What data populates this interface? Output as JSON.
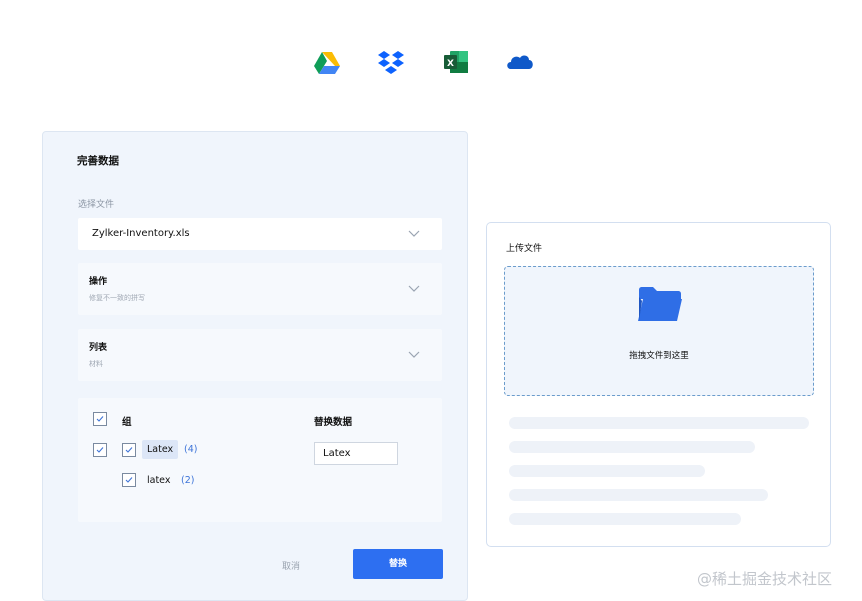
{
  "top_icons": [
    "google-drive-icon",
    "dropbox-icon",
    "excel-icon",
    "onedrive-icon"
  ],
  "left_panel": {
    "title": "完善数据",
    "file_label": "选择文件",
    "file_value": "Zylker-Inventory.xls",
    "action_card": {
      "title": "操作",
      "subtitle": "修复不一致的拼写"
    },
    "list_card": {
      "title": "列表",
      "subtitle": "材料"
    },
    "group": {
      "header": "组",
      "items": [
        {
          "label": "Latex",
          "count": "(4)",
          "checked": true
        },
        {
          "label": "latex",
          "count": "(2)",
          "checked": true
        }
      ],
      "replace_header": "替换数据",
      "replace_value": "Latex"
    },
    "cancel_label": "取消",
    "replace_button": "替换"
  },
  "right_panel": {
    "title": "上传文件",
    "drop_text": "拖拽文件到这里"
  },
  "watermark": "@稀土掘金技术社区",
  "colors": {
    "accent": "#2d6ff1",
    "panel_bg": "#f0f5fc",
    "count_blue": "#3d74d8",
    "folder_blue": "#2f6ee6"
  }
}
